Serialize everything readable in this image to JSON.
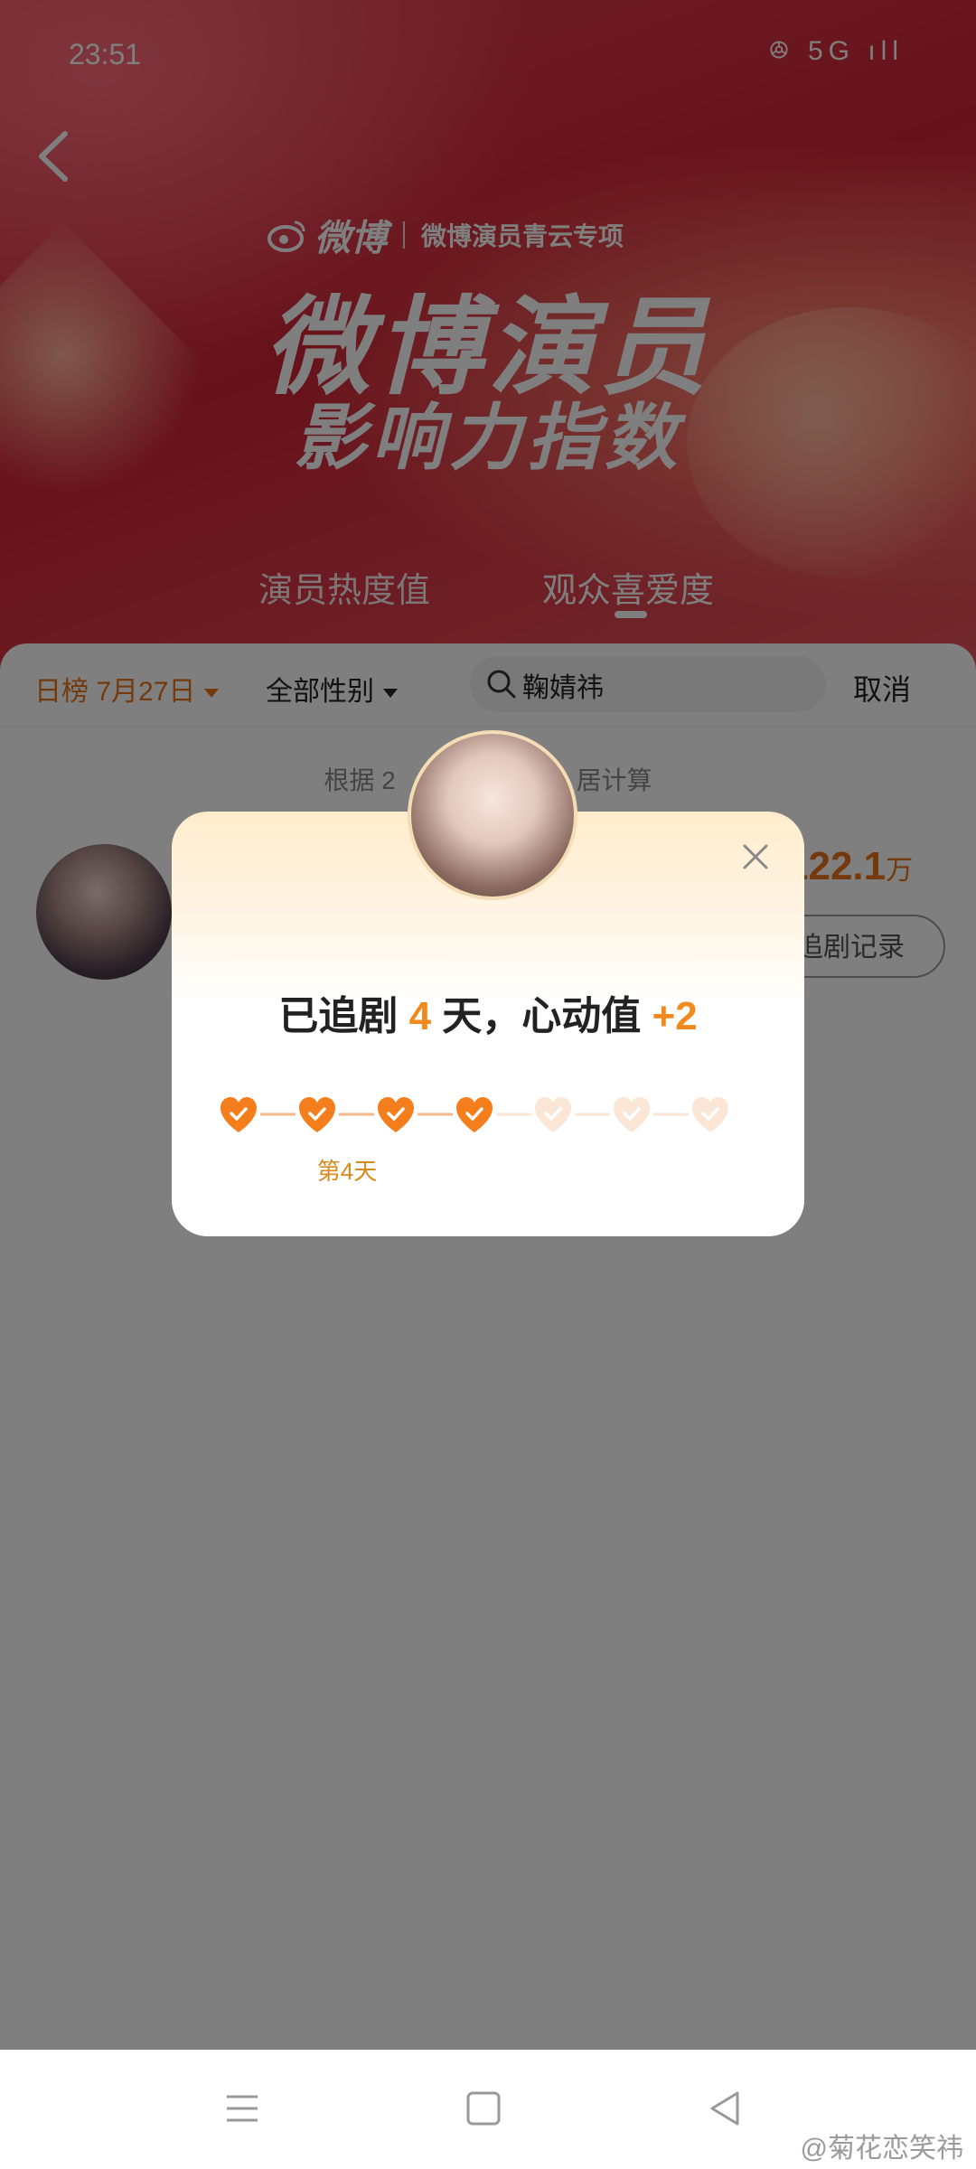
{
  "status_bar": {
    "time": "23:51",
    "icons": [
      "signal-icon",
      "battery-icon"
    ],
    "icons_text": "ꔮ 5G ıll"
  },
  "header": {
    "brand_logo": "微博",
    "brand_subtitle": "微博演员青云专项",
    "title_line1": "微博演员",
    "title_line2": "影响力指数",
    "tabs": [
      {
        "label": "演员热度值",
        "active": false
      },
      {
        "label": "观众喜爱度",
        "active": true
      }
    ]
  },
  "filters": {
    "date": "日榜 7月27日",
    "gender": "全部性别",
    "search_value": "鞠婧祎",
    "cancel_label": "取消"
  },
  "list": {
    "note": "根据 2",
    "note_tail": "居计算",
    "score": "122.1",
    "score_unit": "万",
    "record_button": "追剧记录"
  },
  "modal": {
    "text_prefix": "已追剧 ",
    "days": "4",
    "text_middle": " 天，心动值 ",
    "points": "+2",
    "day_label": "第4天",
    "total_hearts": 7,
    "filled_hearts": 4,
    "colors": {
      "filled": "#f57e1c",
      "empty": "#fbe6d6",
      "accent": "#f08a1c"
    }
  },
  "navbar": {
    "items": [
      "menu-icon",
      "home-square-icon",
      "back-triangle-icon"
    ]
  },
  "watermark": "@菊花恋笑祎"
}
